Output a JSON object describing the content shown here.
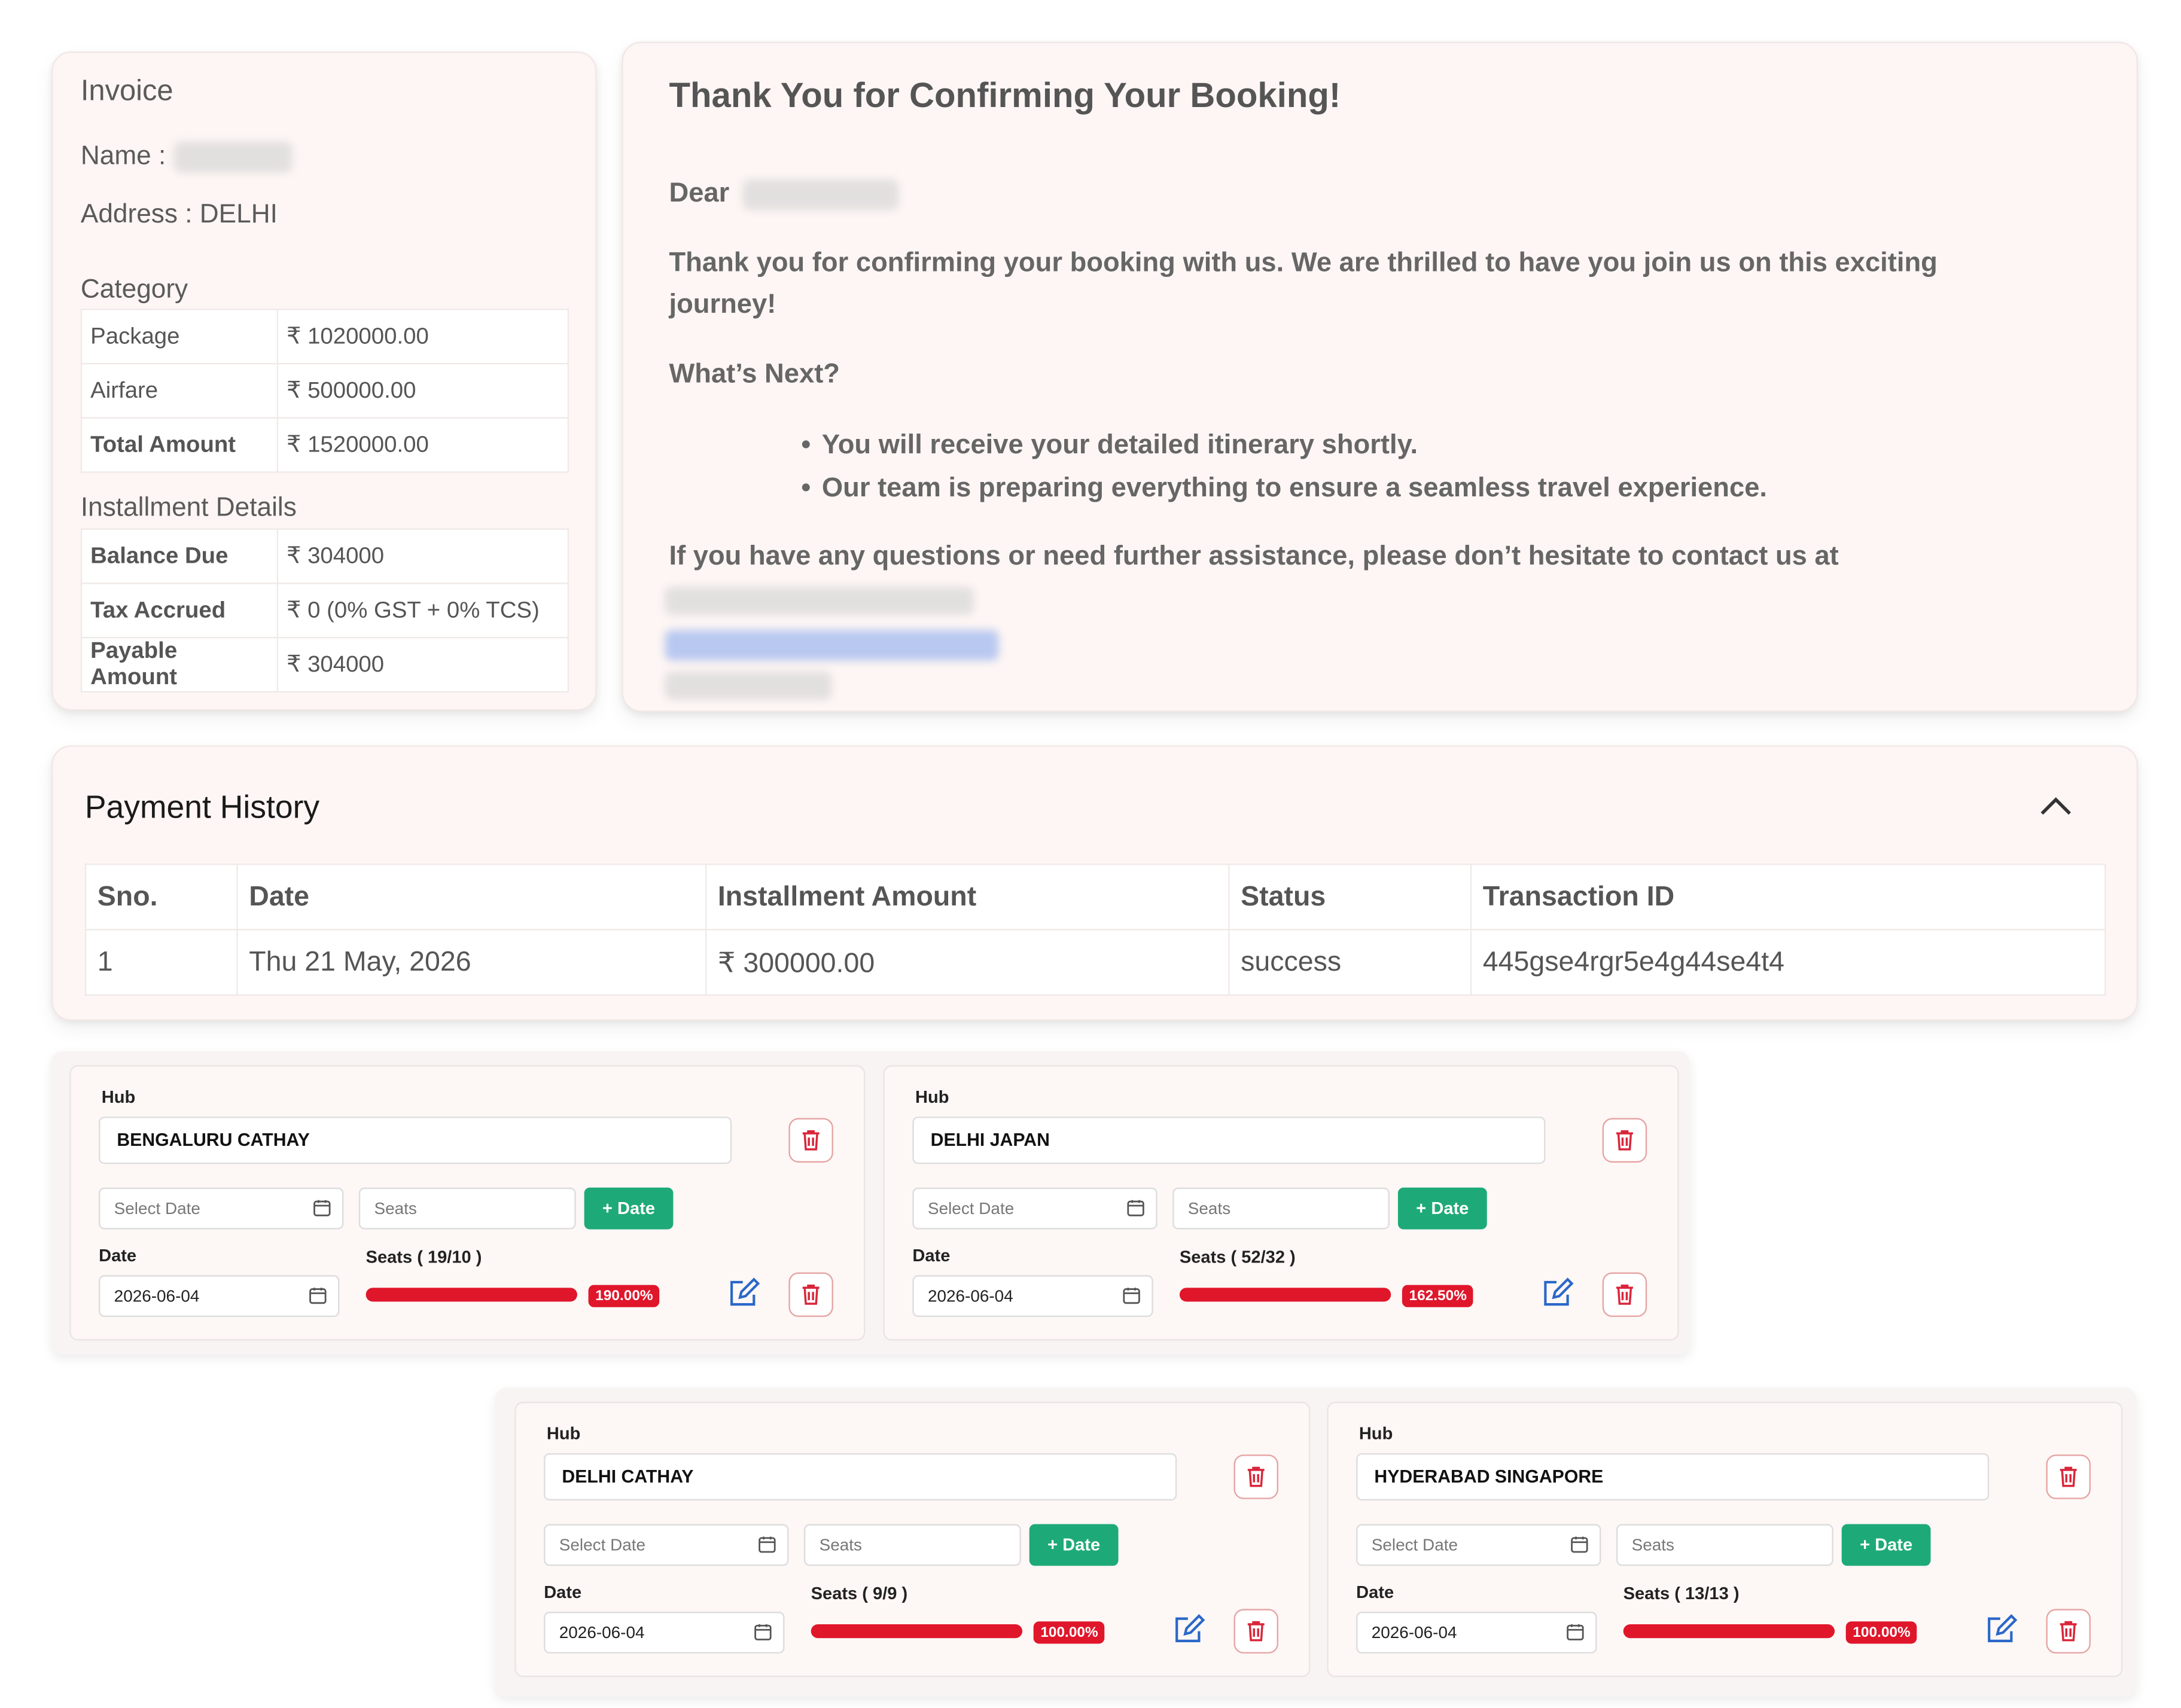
{
  "invoice": {
    "title": "Invoice",
    "name_label": "Name :",
    "address_label": "Address : DELHI",
    "category_heading": "Category",
    "category_rows": [
      {
        "label": "Package",
        "value": "₹ 1020000.00"
      },
      {
        "label": "Airfare",
        "value": "₹ 500000.00"
      },
      {
        "label": "Total Amount",
        "value": "₹ 1520000.00"
      }
    ],
    "installment_heading": "Installment Details",
    "installment_rows": [
      {
        "label": "Balance Due",
        "value": "₹ 304000"
      },
      {
        "label": "Tax Accrued",
        "value": "₹ 0 (0% GST + 0% TCS)"
      },
      {
        "label": "Payable Amount",
        "value": "₹ 304000"
      }
    ]
  },
  "message": {
    "title": "Thank You for Confirming Your Booking!",
    "dear": "Dear",
    "para1": "Thank you for confirming your booking with us. We are thrilled to have you join us on this exciting",
    "para1b": "journey!",
    "whats_next": "What’s Next?",
    "bullets": [
      "You will receive your detailed itinerary shortly.",
      "Our team is preparing everything to ensure a seamless travel experience."
    ],
    "contact": "If you have any questions or need further assistance, please don’t hesitate to contact us at"
  },
  "payment_history": {
    "title": "Payment History",
    "columns": [
      "Sno.",
      "Date",
      "Installment Amount",
      "Status",
      "Transaction ID"
    ],
    "rows": [
      [
        "1",
        "Thu 21 May, 2026",
        "₹ 300000.00",
        "success",
        "445gse4rgr5e4g44se4t4"
      ]
    ]
  },
  "hubs": [
    {
      "hub_label": "Hub",
      "name": "BENGALURU CATHAY",
      "select_date_placeholder": "Select Date",
      "seats_placeholder": "Seats",
      "add_label": "+ Date",
      "date_label": "Date",
      "seats_label": "Seats ( 19/10 )",
      "date_value": "2026-06-04",
      "progress": 1.0,
      "percent": "190.00%"
    },
    {
      "hub_label": "Hub",
      "name": "DELHI JAPAN",
      "select_date_placeholder": "Select Date",
      "seats_placeholder": "Seats",
      "add_label": "+ Date",
      "date_label": "Date",
      "seats_label": "Seats ( 52/32 )",
      "date_value": "2026-06-04",
      "progress": 1.0,
      "percent": "162.50%"
    },
    {
      "hub_label": "Hub",
      "name": "DELHI CATHAY",
      "select_date_placeholder": "Select Date",
      "seats_placeholder": "Seats",
      "add_label": "+ Date",
      "date_label": "Date",
      "seats_label": "Seats ( 9/9 )",
      "date_value": "2026-06-04",
      "progress": 1.0,
      "percent": "100.00%"
    },
    {
      "hub_label": "Hub",
      "name": "HYDERABAD SINGAPORE",
      "select_date_placeholder": "Select Date",
      "seats_placeholder": "Seats",
      "add_label": "+ Date",
      "date_label": "Date",
      "seats_label": "Seats ( 13/13 )",
      "date_value": "2026-06-04",
      "progress": 1.0,
      "percent": "100.00%"
    }
  ],
  "colors": {
    "accent_green": "#1eaa78",
    "danger_red": "#e0162b",
    "card_bg": "#fdf6f4"
  }
}
